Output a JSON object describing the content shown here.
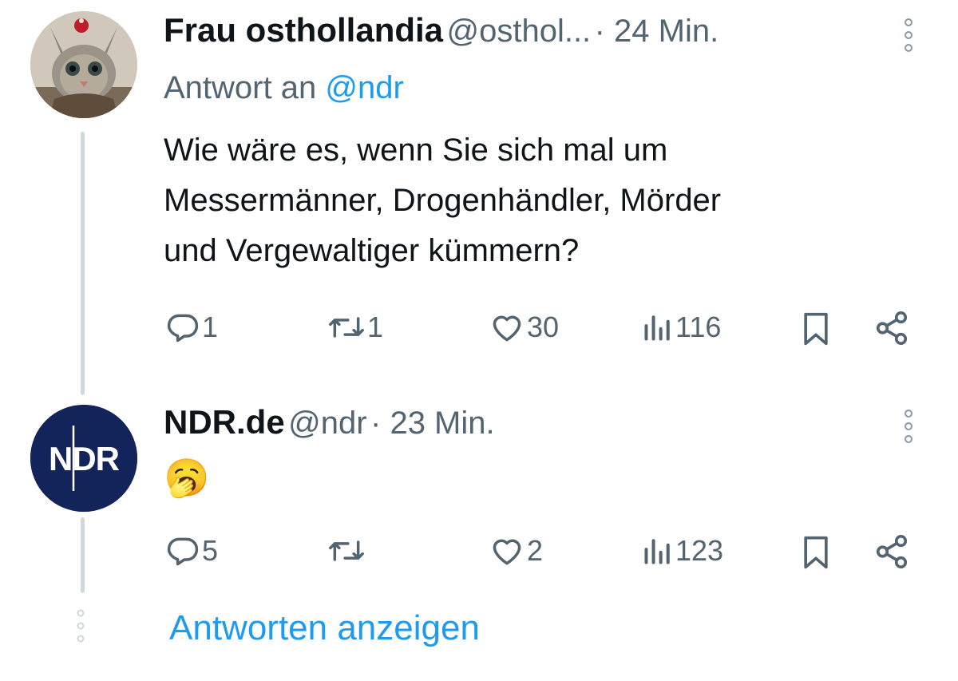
{
  "tweets": [
    {
      "author_name": "Frau osthollandia",
      "handle": "@osthol...",
      "time": "· 24 Min.",
      "reply_prefix": "Antwort an",
      "reply_mention": "@ndr",
      "text_lines": [
        "Wie wäre es, wenn Sie sich mal um",
        "Messermänner, Drogenhändler, Mörder",
        "und Vergewaltiger kümmern?"
      ],
      "replies": "1",
      "retweets": "1",
      "likes": "30",
      "views": "116"
    },
    {
      "author_name": "NDR.de",
      "handle": "@ndr",
      "time": "· 23 Min.",
      "avatar_text": "NDR",
      "text": "🥱",
      "replies": "5",
      "retweets": "",
      "likes": "2",
      "views": "123"
    }
  ],
  "show_replies_label": "Antworten anzeigen",
  "icons": {
    "reply": "reply-icon",
    "retweet": "retweet-icon",
    "like": "heart-icon",
    "views": "views-icon",
    "bookmark": "bookmark-icon",
    "share": "share-icon",
    "more": "more-icon"
  },
  "colors": {
    "link": "#1d9bf0",
    "secondary": "#536471",
    "ndr_brand": "#13245b"
  }
}
